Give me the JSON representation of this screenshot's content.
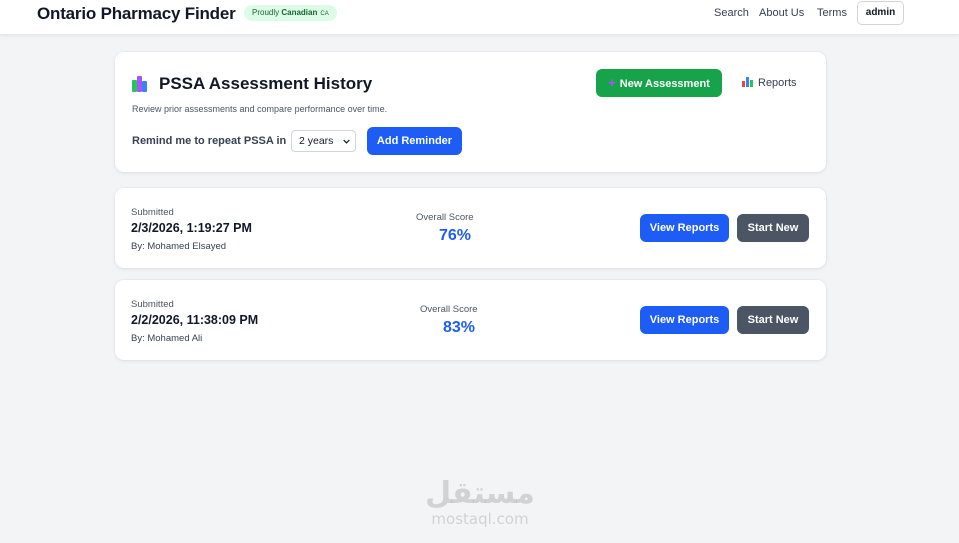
{
  "header": {
    "brand": "Ontario Pharmacy Finder",
    "badge_prefix": "Proudly",
    "badge_strong": "Canadian",
    "badge_flag": "CA",
    "nav": [
      "Search",
      "About Us",
      "Terms"
    ],
    "user_button": "admin"
  },
  "main": {
    "title": "PSSA Assessment History",
    "subtitle": "Review prior assessments and compare performance over time.",
    "new_assessment_label": "New Assessment",
    "reports_label": "Reports",
    "remind_label": "Remind me to repeat PSSA in",
    "remind_selected": "2 years",
    "add_reminder_label": "Add Reminder"
  },
  "assessments": [
    {
      "submitted_label": "Submitted",
      "date": "2/3/2026, 1:19:27 PM",
      "by": "By: Mohamed Elsayed",
      "score_label": "Overall Score",
      "score": "76%",
      "view_label": "View Reports",
      "start_label": "Start New"
    },
    {
      "submitted_label": "Submitted",
      "date": "2/2/2026, 11:38:09 PM",
      "by": "By: Mohamed Ali",
      "score_label": "Overall Score",
      "score": "83%",
      "view_label": "View Reports",
      "start_label": "Start New"
    }
  ],
  "watermark": {
    "arabic": "مستقل",
    "latin": "mostaql.com"
  },
  "colors": {
    "primary": "#1d5cf5",
    "success": "#16a34a",
    "neutral": "#4b5563",
    "badge_bg": "#dcfce7"
  }
}
